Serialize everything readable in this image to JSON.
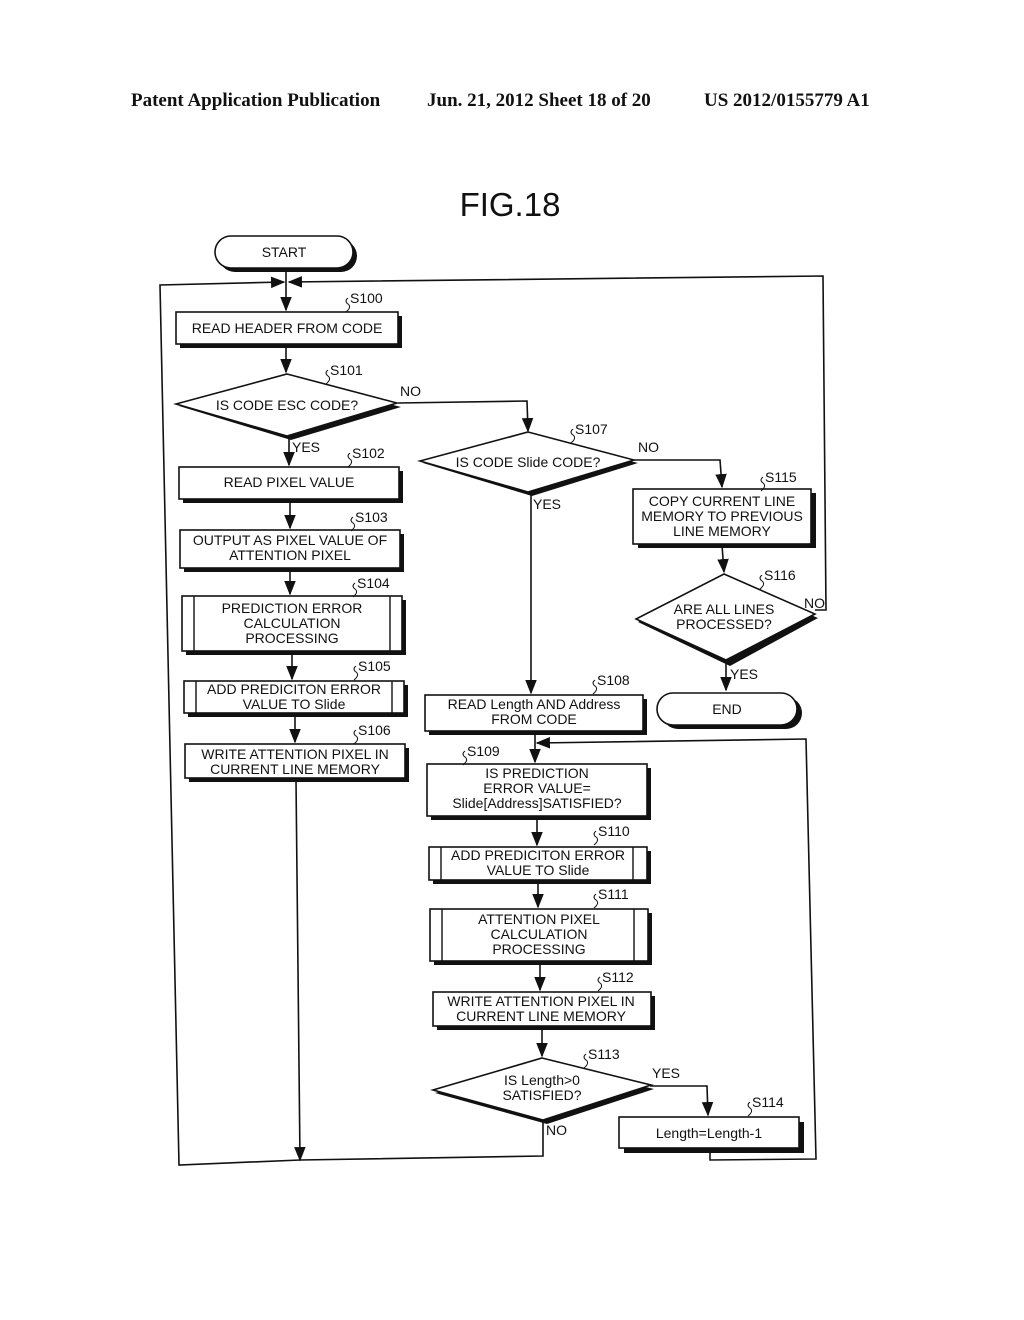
{
  "header": {
    "publication": "Patent Application Publication",
    "date_sheet": "Jun. 21, 2012  Sheet 18 of 20",
    "patent_number": "US 2012/0155779 A1"
  },
  "figure": {
    "title": "FIG.18"
  },
  "nodes": {
    "start": {
      "label": "START"
    },
    "s100": {
      "step": "S100",
      "lines": [
        "READ HEADER FROM CODE"
      ]
    },
    "s101": {
      "step": "S101",
      "lines": [
        "IS CODE ESC CODE?"
      ]
    },
    "s102": {
      "step": "S102",
      "lines": [
        "READ PIXEL VALUE"
      ]
    },
    "s103": {
      "step": "S103",
      "lines": [
        "OUTPUT AS PIXEL VALUE OF",
        "ATTENTION PIXEL"
      ]
    },
    "s104": {
      "step": "S104",
      "lines": [
        "PREDICTION ERROR",
        "CALCULATION",
        "PROCESSING"
      ]
    },
    "s105": {
      "step": "S105",
      "lines": [
        "ADD PREDICITON ERROR",
        "VALUE TO Slide"
      ]
    },
    "s106": {
      "step": "S106",
      "lines": [
        "WRITE ATTENTION PIXEL IN",
        "CURRENT LINE MEMORY"
      ]
    },
    "s107": {
      "step": "S107",
      "lines": [
        "IS CODE Slide CODE?"
      ]
    },
    "s108": {
      "step": "S108",
      "lines": [
        "READ Length AND Address",
        "FROM CODE"
      ]
    },
    "s109": {
      "step": "S109",
      "lines": [
        "IS PREDICTION",
        "ERROR VALUE=",
        "Slide[Address]SATISFIED?"
      ]
    },
    "s110": {
      "step": "S110",
      "lines": [
        "ADD PREDICITON ERROR",
        "VALUE TO Slide"
      ]
    },
    "s111": {
      "step": "S111",
      "lines": [
        "ATTENTION PIXEL",
        "CALCULATION",
        "PROCESSING"
      ]
    },
    "s112": {
      "step": "S112",
      "lines": [
        "WRITE ATTENTION PIXEL IN",
        "CURRENT LINE MEMORY"
      ]
    },
    "s113": {
      "step": "S113",
      "lines": [
        "IS Length>0",
        "SATISFIED?"
      ]
    },
    "s114": {
      "step": "S114",
      "lines": [
        "Length=Length-1"
      ]
    },
    "s115": {
      "step": "S115",
      "lines": [
        "COPY CURRENT LINE",
        "MEMORY TO PREVIOUS",
        "LINE MEMORY"
      ]
    },
    "s116": {
      "step": "S116",
      "lines": [
        "ARE ALL LINES",
        "PROCESSED?"
      ]
    },
    "end": {
      "label": "END"
    }
  },
  "branch_labels": {
    "s101_no": "NO",
    "s101_yes": "YES",
    "s107_no": "NO",
    "s107_yes": "YES",
    "s116_no": "NO",
    "s116_yes": "YES",
    "s113_yes": "YES",
    "s113_no": "NO"
  }
}
